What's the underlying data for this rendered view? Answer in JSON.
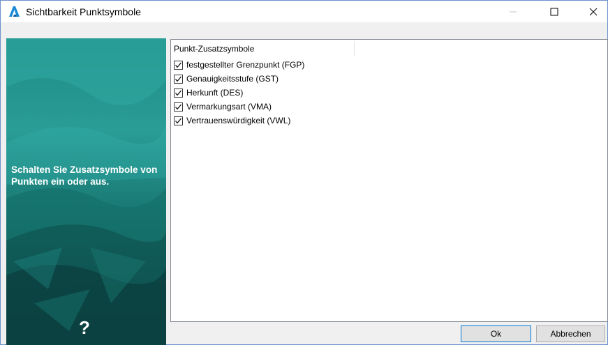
{
  "window": {
    "title": "Sichtbarkeit Punktsymbole",
    "accent_color": "#0078d7"
  },
  "side_panel": {
    "description": "Schalten Sie Zusatzsymbole von Punkten ein oder aus.",
    "help_label": "?"
  },
  "list": {
    "column_header": "Punkt-Zusatzsymbole",
    "items": [
      {
        "label": "festgestellter Grenzpunkt (FGP)",
        "checked": true
      },
      {
        "label": "Genauigkeitsstufe (GST)",
        "checked": true
      },
      {
        "label": "Herkunft (DES)",
        "checked": true
      },
      {
        "label": "Vermarkungsart (VMA)",
        "checked": true
      },
      {
        "label": "Vertrauenswürdigkeit (VWL)",
        "checked": true
      }
    ]
  },
  "buttons": {
    "ok": "Ok",
    "cancel": "Abbrechen"
  }
}
